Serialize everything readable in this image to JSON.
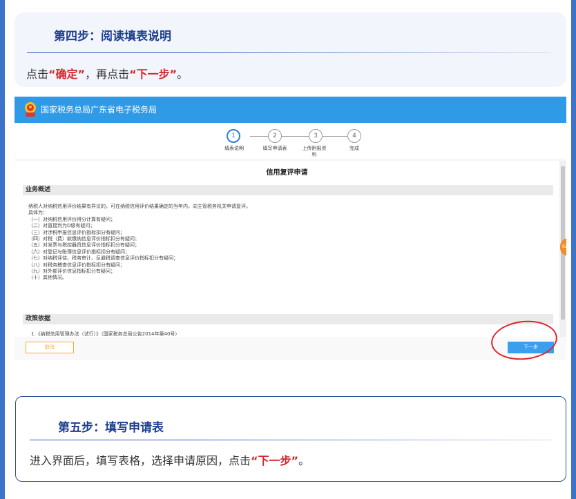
{
  "step4": {
    "title": "第四步：阅读填表说明",
    "desc_pre": "点击",
    "desc_hl1": "“确定”",
    "desc_mid": "，再点击",
    "desc_hl2": "“下一步”",
    "desc_post": "。"
  },
  "screenshot": {
    "header_title": "国家税务总局广东省电子税务局",
    "steps": [
      {
        "num": "1",
        "label": "填表说明"
      },
      {
        "num": "2",
        "label": "填写申请表"
      },
      {
        "num": "3",
        "label": "上传附报资料"
      },
      {
        "num": "4",
        "label": "完成"
      }
    ],
    "content_title": "信用复评申请",
    "section1": "业务概述",
    "intro": "纳税人对纳税信用评价结果有异议的，可在纳税信用评价结果确定的当年内，向主管税务机关申请复评。",
    "intro2": "具体为：",
    "items": [
      "（一）对纳税信用评价得分计算有疑问；",
      "（二）对直接判为D级有疑问；",
      "（三）对涉税申报信息评价指标扣分有疑问；",
      "（四）对税（费）款缴纳信息评价指标扣分有疑问；",
      "（五）对发票与税控器具信息评价指标扣分有疑问；",
      "（六）对登记与账簿信息评价指标扣分有疑问；",
      "（七）对纳税评估、税务审计、反避税调查信息评价指标扣分有疑问；",
      "（八）对税务稽查信息评价指标扣分有疑问；",
      "（九）对外部评价信息指标扣分有疑问；",
      "（十）其他情况。"
    ],
    "section2": "政策依据",
    "policy_line": "1.《纳税信用管理办法（试行）》（国家税务总局公告2014年第40号）",
    "side_badge": "82",
    "cancel_label": "取消",
    "next_label": "下一步"
  },
  "step5": {
    "title": "第五步：填写申请表",
    "desc_pre": "进入界面后，填写表格，选择申请原因，点击",
    "desc_hl": "“下一步”",
    "desc_post": "。"
  },
  "colors": {
    "outer": "#3d73c9",
    "title": "#1d3f8f",
    "highlight": "#d3262b",
    "header": "#2f9be6"
  }
}
